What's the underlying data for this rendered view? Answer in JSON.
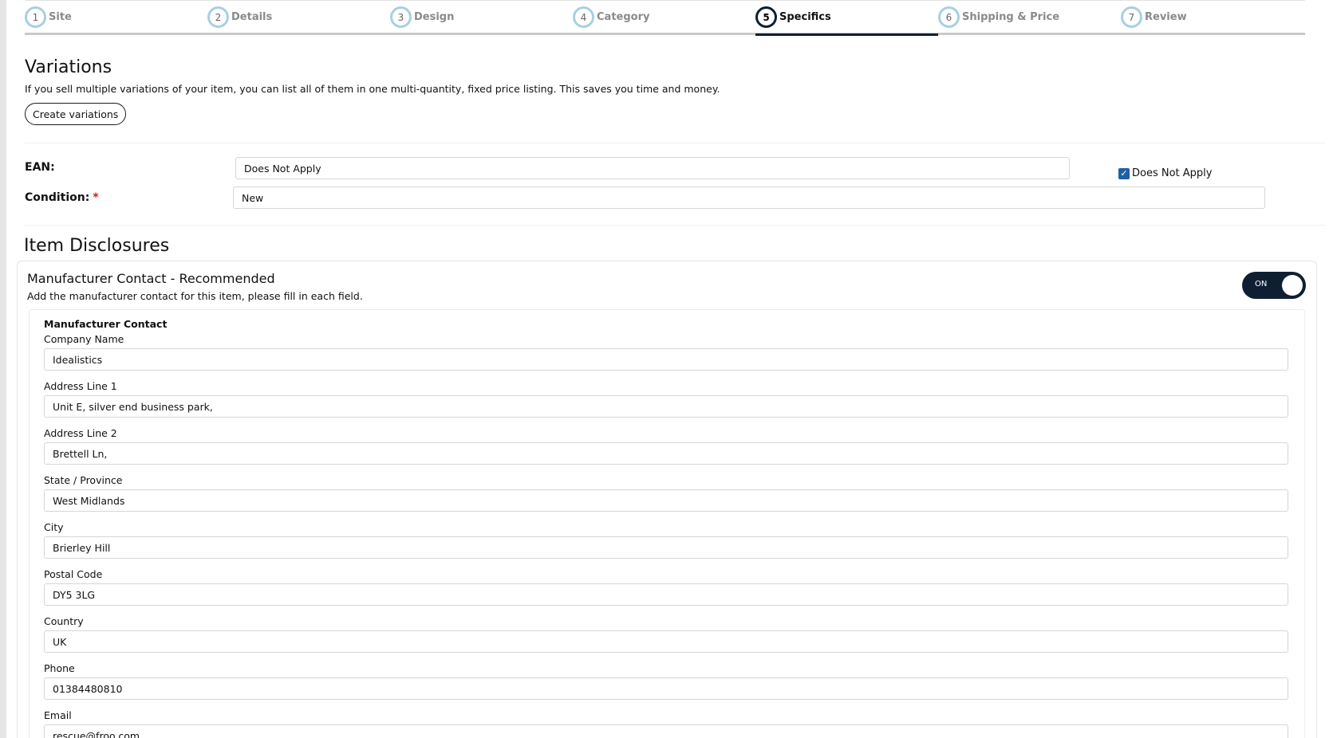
{
  "stepper": {
    "steps": [
      {
        "number": "1",
        "label": "Site"
      },
      {
        "number": "2",
        "label": "Details"
      },
      {
        "number": "3",
        "label": "Design"
      },
      {
        "number": "4",
        "label": "Category"
      },
      {
        "number": "5",
        "label": "Specifics"
      },
      {
        "number": "6",
        "label": "Shipping & Price"
      },
      {
        "number": "7",
        "label": "Review"
      }
    ],
    "active_step": "Specifics"
  },
  "variations": {
    "title": "Variations",
    "description": "If you sell multiple variations of your item, you can list all of them in one multi-quantity, fixed price listing. This saves you time and money.",
    "button_label": "Create variations"
  },
  "ean": {
    "label": "EAN:",
    "value": "Does Not Apply",
    "checkbox_label": "Does Not Apply",
    "checkbox_checked": true
  },
  "condition": {
    "label": "Condition:",
    "required_marker": "*",
    "value": "New"
  },
  "disclosures": {
    "title": "Item Disclosures",
    "manufacturer": {
      "title": "Manufacturer Contact - Recommended",
      "description": "Add the manufacturer contact for this item, please fill in each field.",
      "toggle_label": "ON",
      "toggle_on": true,
      "section_title": "Manufacturer Contact",
      "fields": {
        "company_name": {
          "label": "Company Name",
          "value": "Idealistics"
        },
        "address_line_1": {
          "label": "Address Line 1",
          "value": "Unit E, silver end business park,"
        },
        "address_line_2": {
          "label": "Address Line 2",
          "value": "Brettell Ln,"
        },
        "state_province": {
          "label": "State / Province",
          "value": "West Midlands"
        },
        "city": {
          "label": "City",
          "value": "Brierley Hill"
        },
        "postal_code": {
          "label": "Postal Code",
          "value": "DY5 3LG"
        },
        "country": {
          "label": "Country",
          "value": "UK"
        },
        "phone": {
          "label": "Phone",
          "value": "01384480810"
        },
        "email": {
          "label": "Email",
          "value": "rescue@froo.com"
        }
      }
    }
  },
  "colors": {
    "accent": "#0f1f33",
    "step_ring": "#a8cfe3",
    "checkbox": "#1f5fa6",
    "required": "#d01b1b"
  }
}
